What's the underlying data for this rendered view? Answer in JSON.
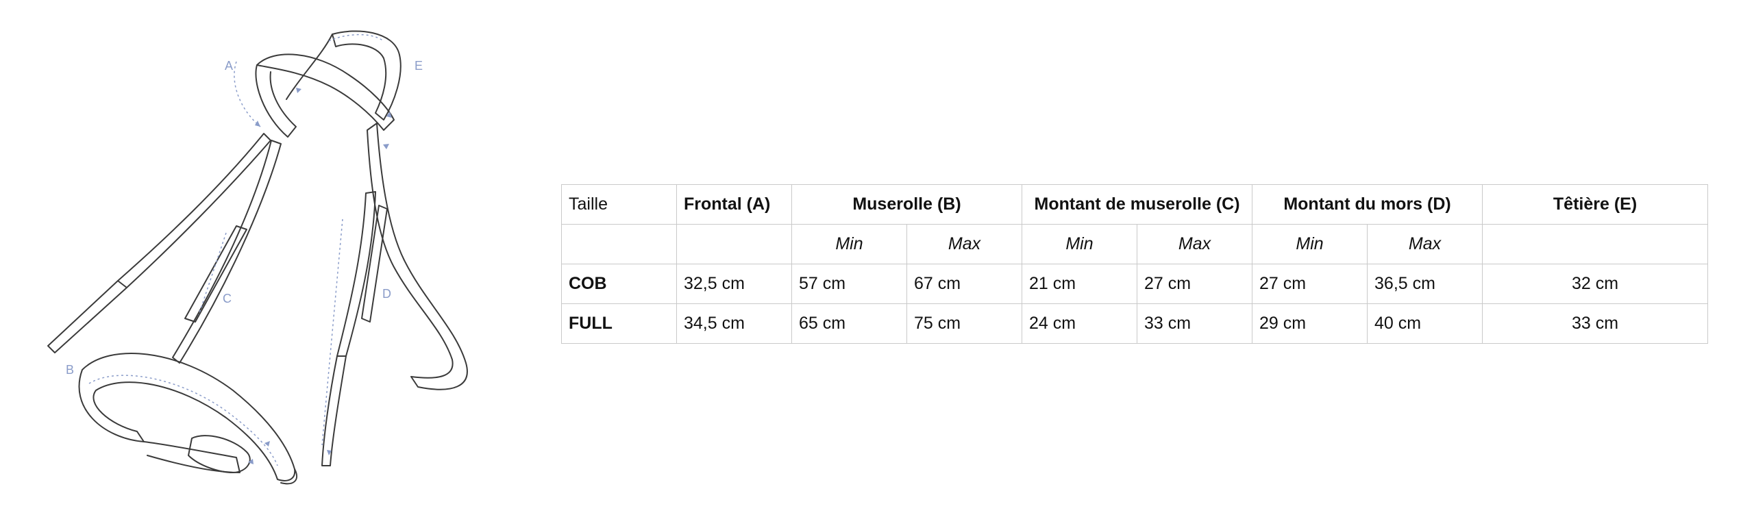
{
  "diagram": {
    "labels": {
      "a": "A",
      "b": "B",
      "c": "C",
      "d": "D",
      "e": "E"
    }
  },
  "table": {
    "header": {
      "taille": "Taille",
      "frontal": "Frontal (A)",
      "muserolle": "Muserolle (B)",
      "montant_muserolle": "Montant de muserolle (C)",
      "montant_mors": "Montant du mors (D)",
      "tetiere": "Têtière (E)"
    },
    "subheader": {
      "muserolle_min": "Min",
      "muserolle_max": "Max",
      "montant_muserolle_min": "Min",
      "montant_muserolle_max": "Max",
      "montant_mors_min": "Min",
      "montant_mors_max": "Max"
    },
    "rows": [
      {
        "taille": "COB",
        "frontal": "32,5 cm",
        "muserolle_min": "57 cm",
        "muserolle_max": "67 cm",
        "montant_muserolle_min": "21 cm",
        "montant_muserolle_max": "27 cm",
        "montant_mors_min": "27 cm",
        "montant_mors_max": "36,5 cm",
        "tetiere": "32 cm"
      },
      {
        "taille": "FULL",
        "frontal": "34,5 cm",
        "muserolle_min": "65 cm",
        "muserolle_max": "75 cm",
        "montant_muserolle_min": "24 cm",
        "montant_muserolle_max": "33 cm",
        "montant_mors_min": "29 cm",
        "montant_mors_max": "40 cm",
        "tetiere": "33 cm"
      }
    ]
  }
}
